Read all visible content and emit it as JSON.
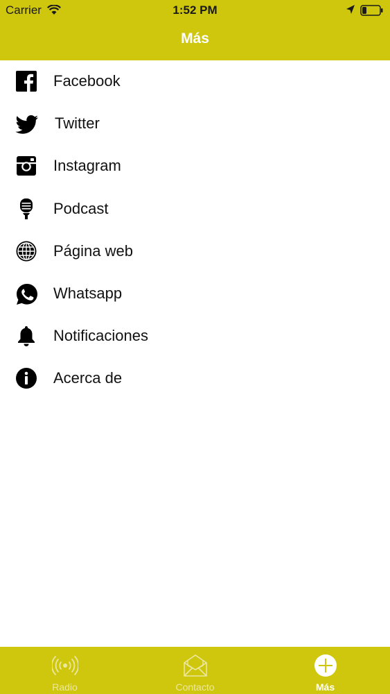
{
  "status_bar": {
    "carrier": "Carrier",
    "time": "1:52 PM",
    "battery_level": 0.25
  },
  "nav": {
    "title": "Más"
  },
  "menu": {
    "items": [
      {
        "label": "Facebook",
        "icon": "facebook-icon"
      },
      {
        "label": "Twitter",
        "icon": "twitter-icon"
      },
      {
        "label": "Instagram",
        "icon": "instagram-icon"
      },
      {
        "label": "Podcast",
        "icon": "microphone-icon"
      },
      {
        "label": "Página web",
        "icon": "globe-icon"
      },
      {
        "label": "Whatsapp",
        "icon": "whatsapp-icon"
      },
      {
        "label": "Notificaciones",
        "icon": "bell-icon"
      },
      {
        "label": "Acerca de",
        "icon": "info-icon"
      }
    ]
  },
  "tabs": [
    {
      "label": "Radio",
      "icon": "radio-broadcast-icon",
      "active": false
    },
    {
      "label": "Contacto",
      "icon": "envelope-icon",
      "active": false
    },
    {
      "label": "Más",
      "icon": "plus-circle-icon",
      "active": true
    }
  ],
  "colors": {
    "accent": "#cfc70d",
    "tab_inactive": "#ece7a0",
    "tab_active": "#ffffff"
  }
}
